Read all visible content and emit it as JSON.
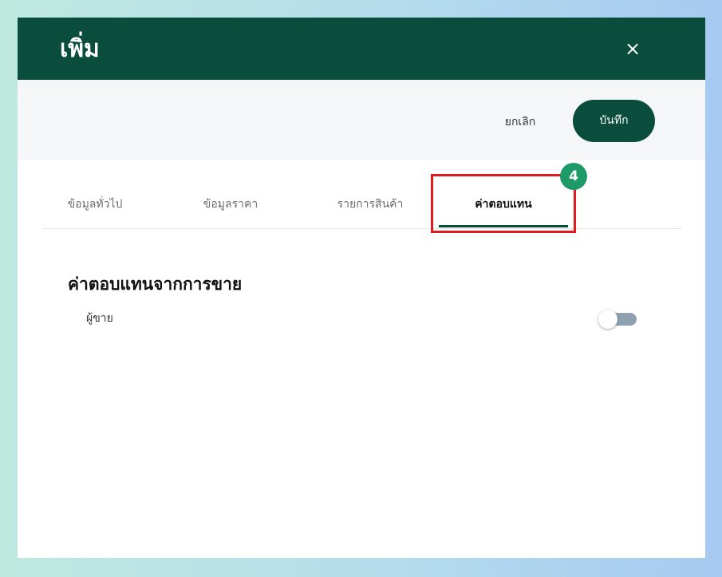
{
  "dialog": {
    "title": "เพิ่ม",
    "close_icon": "×"
  },
  "toolbar": {
    "cancel_label": "ยกเลิก",
    "save_label": "บันทึก"
  },
  "tabs": [
    {
      "label": "ข้อมูลทั่วไป",
      "active": false
    },
    {
      "label": "ข้อมูลราคา",
      "active": false
    },
    {
      "label": "รายการสินค้า",
      "active": false
    },
    {
      "label": "ค่าตอบแทน",
      "active": true
    }
  ],
  "annotation": {
    "step": "4",
    "highlight_color": "#e11b1b",
    "badge_color": "#1e9a69"
  },
  "section": {
    "title": "ค่าตอบแทนจากการขาย",
    "seller_label": "ผู้ขาย",
    "seller_toggle_on": false
  },
  "colors": {
    "brand": "#0b4d3c",
    "toggle_track": "#8fa1b1"
  }
}
